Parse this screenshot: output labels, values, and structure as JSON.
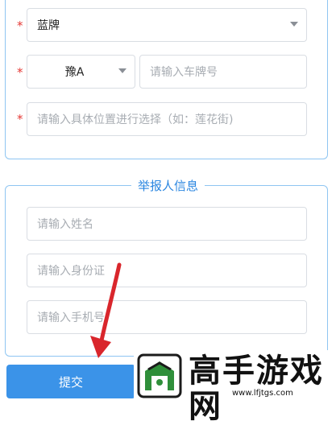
{
  "vehicle": {
    "plate_type": {
      "value": "蓝牌"
    },
    "plate_prefix": {
      "value": "豫A"
    },
    "plate_number": {
      "placeholder": "请输入车牌号"
    },
    "location": {
      "placeholder": "请输入具体位置进行选择（如：莲花街)"
    }
  },
  "reporter": {
    "legend": "举报人信息",
    "name": {
      "placeholder": "请输入姓名"
    },
    "id_card": {
      "placeholder": "请输入身份证"
    },
    "phone": {
      "placeholder": "请输入手机号"
    }
  },
  "submit_label": "提交",
  "required_mark": "*",
  "watermark": {
    "title": "高手游戏网",
    "url": "www.lfjtgs.com"
  },
  "colors": {
    "accent": "#3b93e8",
    "required": "#e53935",
    "arrow": "#d9262c",
    "border": "#8ec5f2"
  }
}
